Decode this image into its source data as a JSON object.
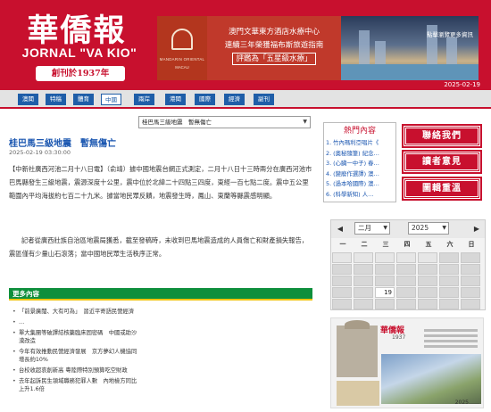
{
  "header": {
    "logo_cn": "華僑報",
    "logo_en": "JORNAL \"VA KIO\"",
    "since": "創刊於1937年",
    "date": "2025-02-19",
    "banner": {
      "line1": "澳門文華東方酒店水療中心",
      "line2": "連續三年榮獲福布斯旅遊指南",
      "line3": "評鑑為「五星級水療」",
      "brand_name": "MANDARIN ORIENTAL",
      "brand_city": "MACAU",
      "more_link": "點擊瀏覽更多資訊"
    }
  },
  "nav": {
    "items": [
      "澳聞",
      "特稿",
      "體育",
      "中國",
      "兩岸",
      "港聞",
      "國際",
      "經濟",
      "副刊"
    ],
    "active_index": 3
  },
  "article": {
    "select_value": "桂巴馬三級地震　暫無傷亡",
    "title": "桂巴馬三級地震　暫無傷亡",
    "timestamp": "2025-02-19 03:30:00",
    "para1": "【中新社廣西河池二月十八日電】（俞靖）據中國地震台網正式測定，二月十八日十三時兩分在廣西河池市巴馬縣發生三級地震，震源深度十公里，震中位於北緯二十四點三四度，東經一百七點二度。震中五公里範圍內平均海拔約七百二十九米。據當地民眾反饋，地震發生時，鳳山、東蘭等縣震感明顯。",
    "para2": "記者從廣西壯族自治區地震局獲悉，截至發稿時，未收到巴馬地震造成的人員傷亡和財產損失報告，震區僅有少量山石滾落；當中國地民眾生活秩序正常。"
  },
  "more": {
    "title": "更多內容",
    "items": [
      "「前景廣闊、大有可為」　習近平寄語民營經濟",
      "…",
      "單大集團等破譯結核藥臨床固密碼　中國或助沙漠改造",
      "今年有效推動民營經濟發展　京方夢幻人機協同增長約10%",
      "台校收超哀創新高 粵陸際特別預算吃空財政",
      "去年起訴民生領域職務犯罪人數　內地檢方同比上升1.6倍"
    ]
  },
  "hot": {
    "title": "熱門內容",
    "items": [
      "1. 竹內瑪利亞唱片《",
      "2. (奧秘隨筆) 紀念…",
      "3. (心臟一中子) 春…",
      "4. (變廢作選譯) 澳…",
      "5. (過本哈國際) 澳…",
      "6. (科學新知) 人…"
    ]
  },
  "buttons": {
    "contact": "聯絡我們",
    "opinion": "讀者意見",
    "archive": "圖輯重溫"
  },
  "calendar": {
    "prev": "◀",
    "next": "▶",
    "month": "二月",
    "year": "2025",
    "weekdays": [
      "一",
      "二",
      "三",
      "四",
      "五",
      "六",
      "日"
    ],
    "today": "19"
  },
  "ad2": {
    "logo": "華僑報",
    "year": "1937",
    "footer": "2025……"
  },
  "colors": {
    "brand_red": "#c8102e",
    "nav_blue": "#1f5ea8",
    "section_green": "#0e8f3c",
    "link_blue": "#1a56b0"
  }
}
